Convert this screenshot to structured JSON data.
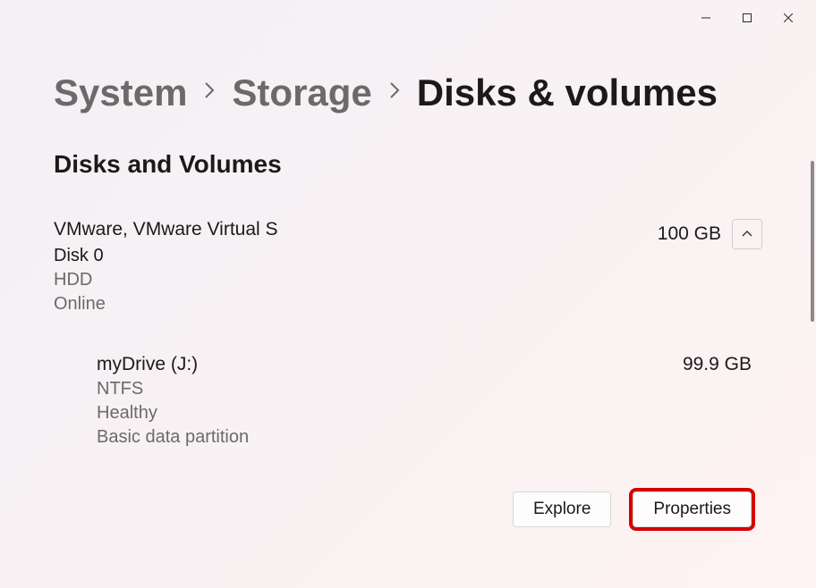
{
  "breadcrumb": {
    "item1": "System",
    "item2": "Storage",
    "item3": "Disks & volumes"
  },
  "section_title": "Disks and Volumes",
  "disk": {
    "name": "VMware, VMware Virtual S",
    "size": "100 GB",
    "id": "Disk 0",
    "type": "HDD",
    "status": "Online"
  },
  "volume": {
    "name": "myDrive (J:)",
    "size": "99.9 GB",
    "fs": "NTFS",
    "health": "Healthy",
    "partition": "Basic data partition"
  },
  "actions": {
    "explore": "Explore",
    "properties": "Properties"
  }
}
